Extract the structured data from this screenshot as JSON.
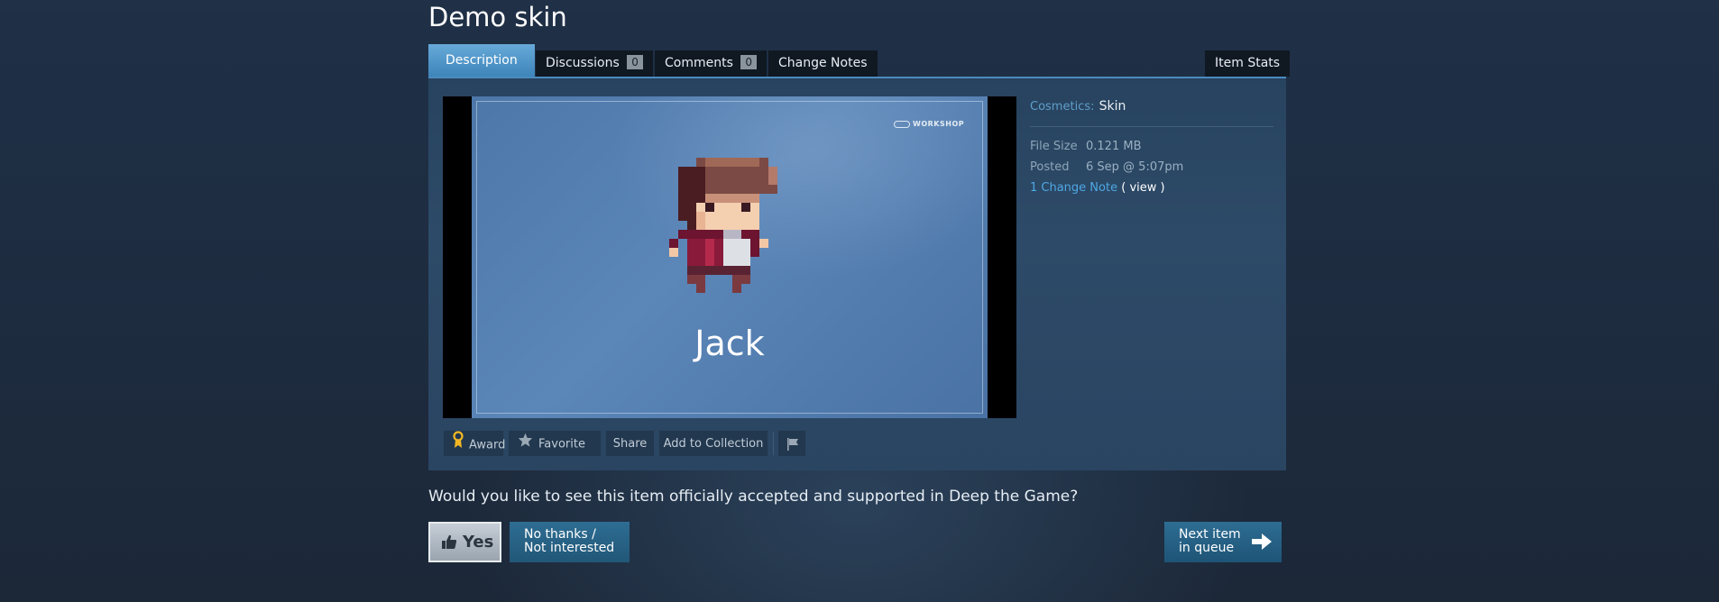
{
  "page": {
    "title": "Demo skin"
  },
  "tabs": {
    "description": "Description",
    "discussions": "Discussions",
    "discussions_count": "0",
    "comments": "Comments",
    "comments_count": "0",
    "change_notes": "Change Notes",
    "item_stats": "Item Stats"
  },
  "preview": {
    "workshop_badge": "WORKSHOP",
    "character_name": "Jack"
  },
  "actions": {
    "award": "Award",
    "favorite": "Favorite",
    "share": "Share",
    "add_to_collection": "Add to Collection",
    "award_icon": "award-ribbon-icon",
    "favorite_icon": "star-icon",
    "report_icon": "flag-icon"
  },
  "details": {
    "category_label": "Cosmetics:",
    "category_value": "Skin",
    "file_size_label": "File Size",
    "file_size_value": "0.121 MB",
    "posted_label": "Posted",
    "posted_value": "6 Sep @ 5:07pm",
    "change_note_link": "1 Change Note",
    "change_note_view": "( view )"
  },
  "vote": {
    "question": "Would you like to see this item officially accepted and supported in Deep the Game?",
    "yes": "Yes",
    "no_line1": "No thanks /",
    "no_line2": "Not interested",
    "next_line1": "Next item",
    "next_line2": "in queue",
    "yes_icon": "thumbs-up-icon",
    "next_icon": "arrow-right-icon"
  },
  "colors": {
    "accent": "#4b8bbe",
    "link": "#4fa8e5",
    "tab_active": "#3b82b8",
    "vote_button": "#215777"
  }
}
